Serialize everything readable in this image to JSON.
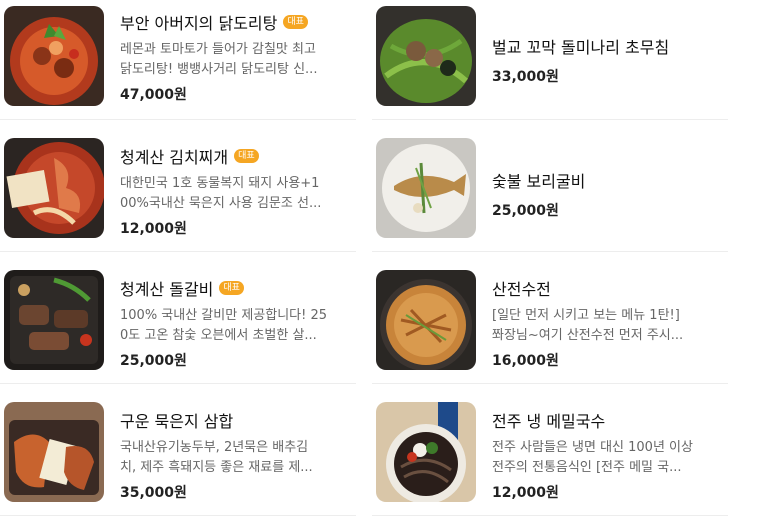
{
  "left": [
    {
      "title": "부안 아버지의 닭도리탕",
      "badge": "대표",
      "desc_lines": [
        "레몬과 토마토가 들어가 감칠맛 최고",
        "닭도리탕! 뱅뱅사거리 닭도리탕 신..."
      ],
      "price": "47,000원"
    },
    {
      "title": "청계산 김치찌개",
      "badge": "대표",
      "desc_lines": [
        "대한민국 1호 동물복지 돼지 사용+1",
        "00%국내산 묵은지 사용 김문조 선..."
      ],
      "price": "12,000원"
    },
    {
      "title": "청계산 돌갈비",
      "badge": "대표",
      "desc_lines": [
        "100% 국내산 갈비만 제공합니다! 25",
        "0도 고온 참숯 오븐에서 초벌한 살..."
      ],
      "price": "25,000원"
    },
    {
      "title": "구운 묵은지 삼합",
      "badge": "",
      "desc_lines": [
        "국내산유기농두부, 2년묵은 배추김",
        "치, 제주 흑돼지등 좋은 재료를 제..."
      ],
      "price": "35,000원"
    }
  ],
  "right": [
    {
      "title": "벌교 꼬막 돌미나리 초무침",
      "badge": "",
      "desc_lines": [],
      "price": "33,000원"
    },
    {
      "title": "숯불 보리굴비",
      "badge": "",
      "desc_lines": [],
      "price": "25,000원"
    },
    {
      "title": "산전수전",
      "badge": "",
      "desc_lines": [
        "[일단 먼저 시키고 보는 메뉴 1탄!]",
        "쫘장님~여기 산전수전 먼저 주시..."
      ],
      "price": "16,000원"
    },
    {
      "title": "전주 냉 메밀국수",
      "badge": "",
      "desc_lines": [
        "전주 사람들은 냉면 대신 100년 이상",
        "전주의 전통음식인 [전주 메밀 국..."
      ],
      "price": "12,000원"
    }
  ],
  "colors": {
    "badge": "#f5a623",
    "price": "#222222",
    "desc": "#666666"
  }
}
